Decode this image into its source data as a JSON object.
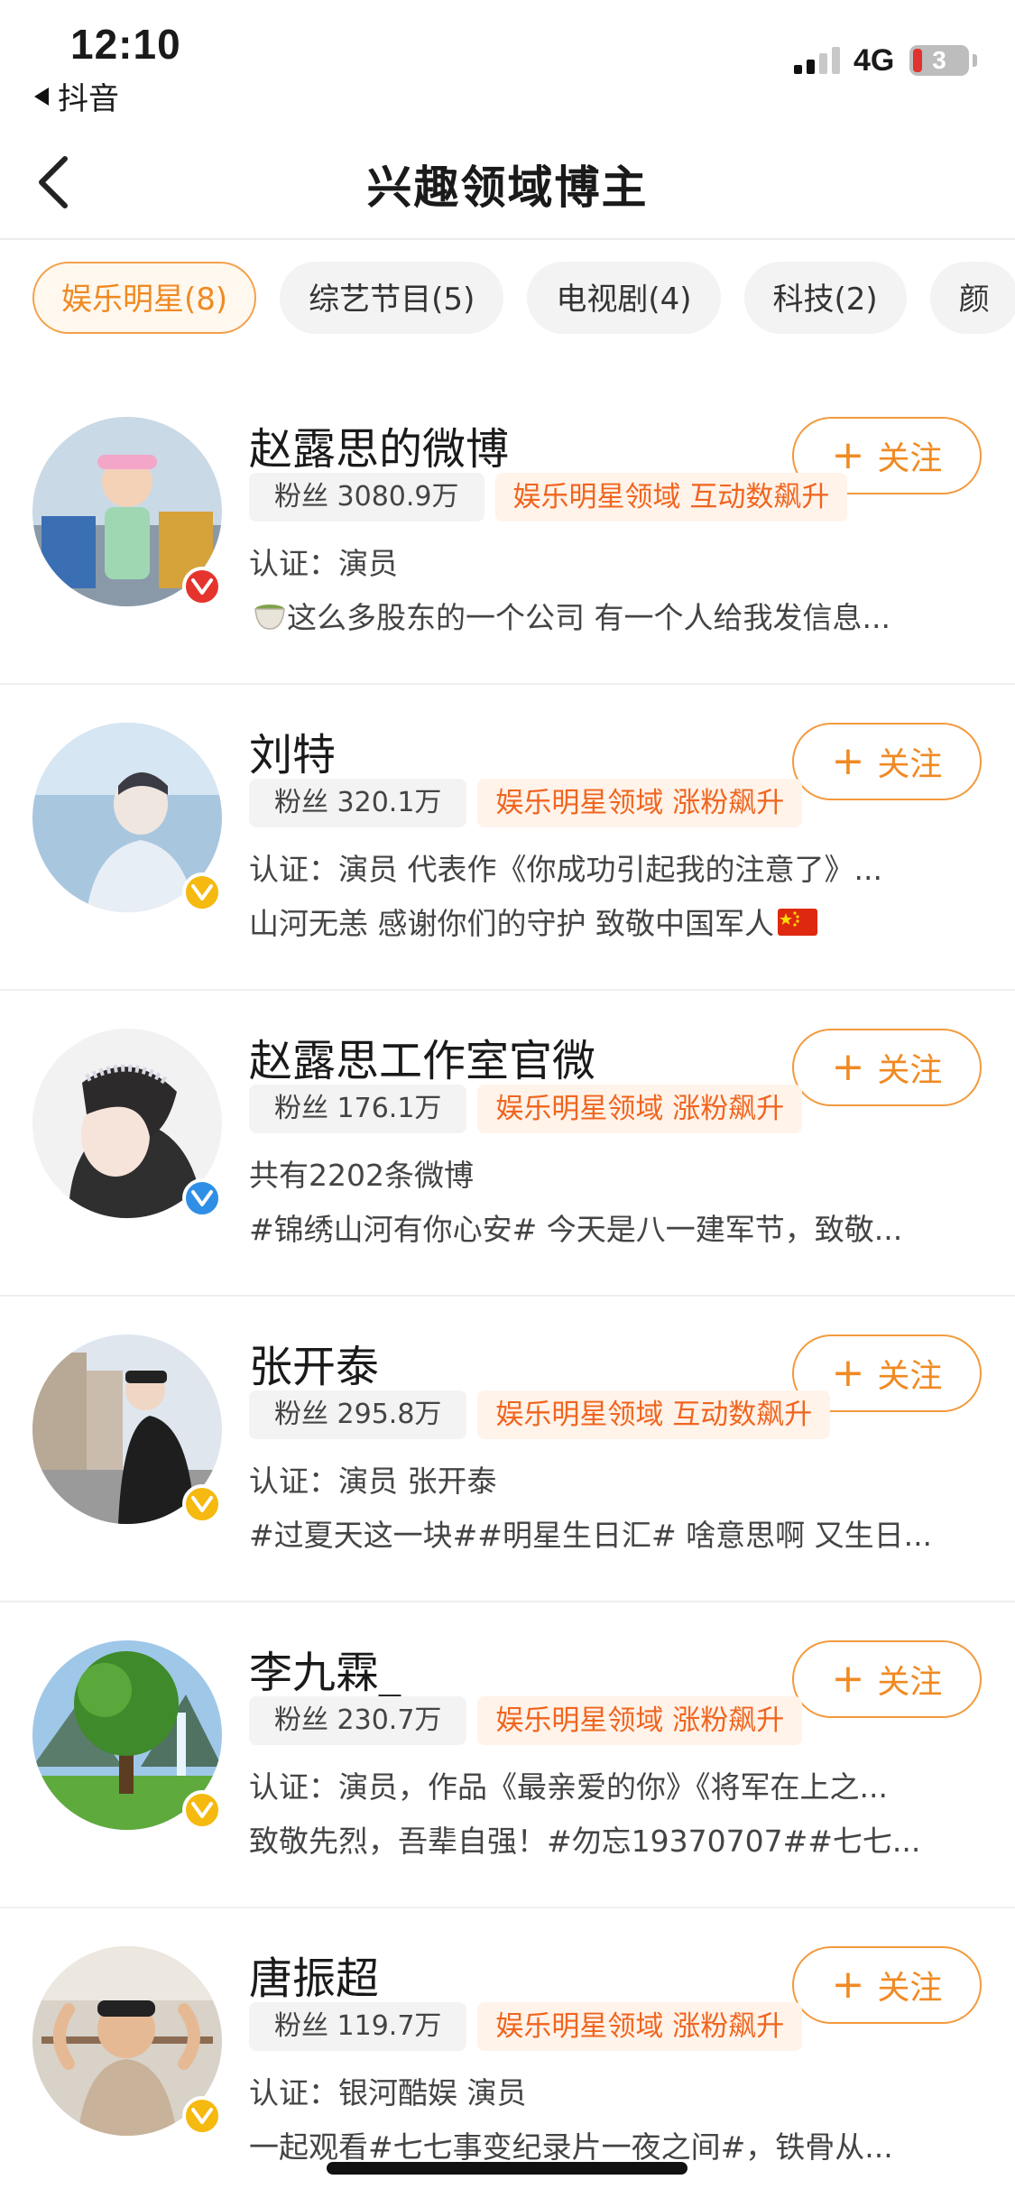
{
  "status": {
    "time": "12:10",
    "back_app": "抖音",
    "network": "4G",
    "battery": "3"
  },
  "nav": {
    "title": "兴趣领域博主"
  },
  "tabs": [
    {
      "label": "娱乐明星(8)",
      "active": true
    },
    {
      "label": "综艺节目(5)",
      "active": false
    },
    {
      "label": "电视剧(4)",
      "active": false
    },
    {
      "label": "科技(2)",
      "active": false
    },
    {
      "label": "颜",
      "active": false
    }
  ],
  "follow_label": "关注",
  "items": [
    {
      "name": "赵露思的微博",
      "fans": "粉丝 3080.9万",
      "hot": "娱乐明星领域 互动数飙升",
      "line1": "认证：演员",
      "line2": "这么多股东的一个公司 有一个人给我发信息...",
      "badge": "red"
    },
    {
      "name": "刘特",
      "fans": "粉丝 320.1万",
      "hot": "娱乐明星领域 涨粉飙升",
      "line1": "认证：演员 代表作《你成功引起我的注意了》...",
      "line2": "山河无恙 感谢你们的守护 致敬中国军人",
      "badge": "yellow"
    },
    {
      "name": "赵露思工作室官微",
      "fans": "粉丝 176.1万",
      "hot": "娱乐明星领域 涨粉飙升",
      "line1": "共有2202条微博",
      "line2": "#锦绣山河有你心安# 今天是八一建军节，致敬...",
      "badge": "blue"
    },
    {
      "name": "张开泰",
      "fans": "粉丝 295.8万",
      "hot": "娱乐明星领域 互动数飙升",
      "line1": "认证：演员 张开泰",
      "line2": "#过夏天这一块##明星生日汇# 啥意思啊 又生日...",
      "badge": "yellow"
    },
    {
      "name": "李九霖_",
      "fans": "粉丝 230.7万",
      "hot": "娱乐明星领域 涨粉飙升",
      "line1": "认证：演员，作品《最亲爱的你》《将军在上之...",
      "line2": "致敬先烈，吾辈自强！#勿忘19370707##七七...",
      "badge": "yellow"
    },
    {
      "name": "唐振超",
      "fans": "粉丝 119.7万",
      "hot": "娱乐明星领域 涨粉飙升",
      "line1": "认证：银河酷娱 演员",
      "line2": "一起观看#七七事变纪录片一夜之间#，铁骨从...",
      "badge": "yellow"
    }
  ],
  "colors": {
    "accent": "#f08a23",
    "hot_text": "#f0651f",
    "badge_red": "#e5342e",
    "badge_yellow": "#f5b90f",
    "badge_blue": "#2f8fe6"
  }
}
